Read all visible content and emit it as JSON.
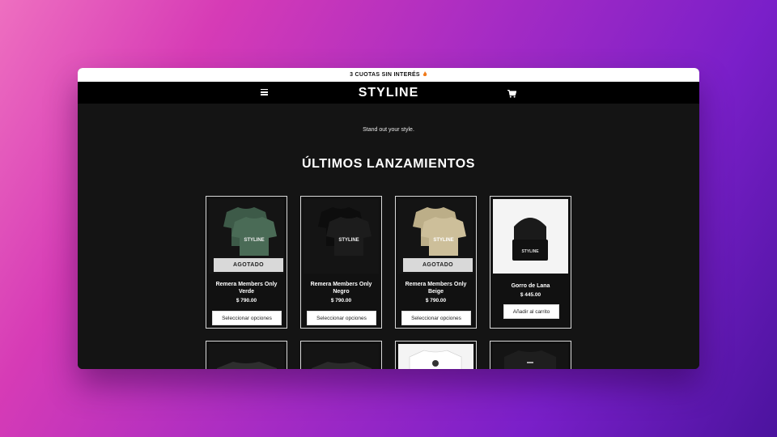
{
  "announcement": {
    "text": "3 CUOTAS SIN INTERÉS",
    "icon": "flame-icon"
  },
  "header": {
    "logo": "STYLINE",
    "menu_icon": "hamburger-menu-icon",
    "cart_icon": "shopping-cart-icon"
  },
  "hero": {
    "tagline": "Stand out your style."
  },
  "section": {
    "title": "ÚLTIMOS LANZAMIENTOS"
  },
  "products": [
    {
      "name": "Remera Members Only Verde",
      "price": "$ 790.00",
      "badge": "AGOTADO",
      "button": "Seleccionar opciones",
      "color": "#3d5a48"
    },
    {
      "name": "Remera Members Only Negro",
      "price": "$ 790.00",
      "badge": "",
      "button": "Seleccionar opciones",
      "color": "#1c1c1c"
    },
    {
      "name": "Remera Members Only Beige",
      "price": "$ 790.00",
      "badge": "AGOTADO",
      "button": "Seleccionar opciones",
      "color": "#cdbf9a"
    },
    {
      "name": "Gorro de Lana",
      "price": "$ 445.00",
      "badge": "",
      "button": "Añadir al carrito",
      "color": "#1a1a1a"
    }
  ],
  "product_print": "STYLINE",
  "colors": {
    "announce_bg": "#ffffff",
    "header_bg": "#000000",
    "page_bg": "#141414",
    "whatsapp": "#22c34f"
  },
  "floating": {
    "icon": "whatsapp-icon"
  }
}
